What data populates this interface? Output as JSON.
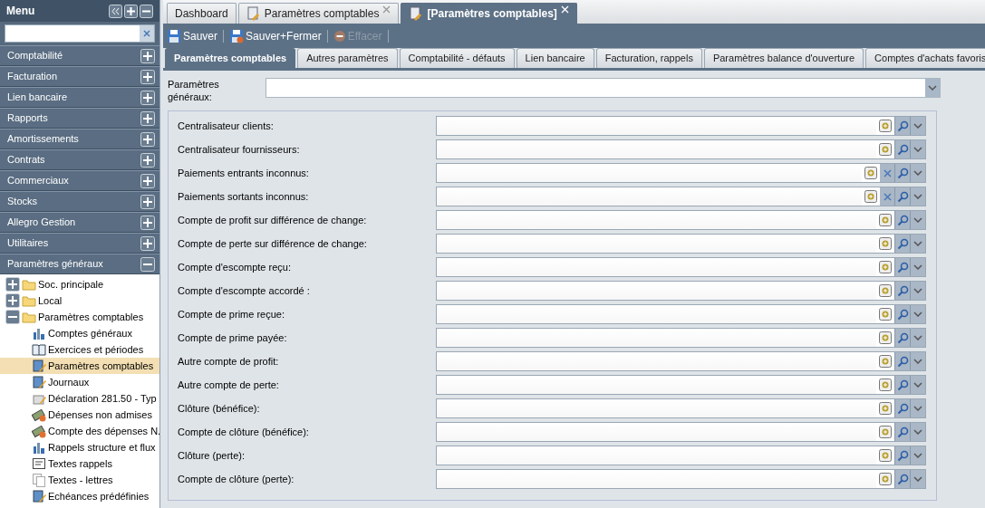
{
  "sidebar": {
    "title": "Menu",
    "search": {
      "clear_button": true
    },
    "sections": [
      {
        "label": "Comptabilité",
        "expanded": false
      },
      {
        "label": "Facturation",
        "expanded": false
      },
      {
        "label": "Lien bancaire",
        "expanded": false
      },
      {
        "label": "Rapports",
        "expanded": false
      },
      {
        "label": "Amortissements",
        "expanded": false
      },
      {
        "label": "Contrats",
        "expanded": false
      },
      {
        "label": "Commerciaux",
        "expanded": false
      },
      {
        "label": "Stocks",
        "expanded": false
      },
      {
        "label": "Allegro Gestion",
        "expanded": false
      },
      {
        "label": "Utilitaires",
        "expanded": false
      },
      {
        "label": "Paramètres généraux",
        "expanded": true
      }
    ],
    "tree": [
      {
        "label": "Soc. principale",
        "kind": "folder",
        "expanded": false,
        "selected": false
      },
      {
        "label": "Local",
        "kind": "folder",
        "expanded": false,
        "selected": false
      },
      {
        "label": "Paramètres comptables",
        "kind": "folder",
        "expanded": true,
        "selected": false,
        "children": [
          {
            "label": "Comptes généraux",
            "kind": "chart",
            "selected": false
          },
          {
            "label": "Exercices et périodes",
            "kind": "book",
            "selected": false
          },
          {
            "label": "Paramètres comptables",
            "kind": "edit",
            "selected": true
          },
          {
            "label": "Journaux",
            "kind": "edit",
            "selected": false
          },
          {
            "label": "Déclaration 281.50 - Typ",
            "kind": "box",
            "selected": false
          },
          {
            "label": "Dépenses non admises",
            "kind": "money",
            "selected": false
          },
          {
            "label": "Compte des dépenses N.",
            "kind": "money",
            "selected": false
          },
          {
            "label": "Rappels structure et flux",
            "kind": "chart",
            "selected": false
          },
          {
            "label": "Textes rappels",
            "kind": "text",
            "selected": false
          },
          {
            "label": "Textes - lettres",
            "kind": "pages",
            "selected": false
          },
          {
            "label": "Echéances prédéfinies",
            "kind": "edit",
            "selected": false
          }
        ]
      }
    ]
  },
  "tabs": [
    {
      "label": "Dashboard",
      "icon": false,
      "closable": false,
      "selected": false
    },
    {
      "label": "Paramètres comptables",
      "icon": true,
      "closable": true,
      "selected": false
    },
    {
      "label": "[Paramètres comptables]",
      "icon": true,
      "closable": true,
      "selected": true
    }
  ],
  "toolbar": [
    {
      "label": "Sauver",
      "kind": "save",
      "disabled": false
    },
    {
      "label": "Sauver+Fermer",
      "kind": "saveclose",
      "disabled": false
    },
    {
      "label": "Effacer",
      "kind": "delete",
      "disabled": true
    }
  ],
  "subtabs": [
    {
      "label": "Paramètres comptables",
      "selected": true
    },
    {
      "label": "Autres paramètres",
      "selected": false
    },
    {
      "label": "Comptabilité - défauts",
      "selected": false
    },
    {
      "label": "Lien bancaire",
      "selected": false
    },
    {
      "label": "Facturation, rappels",
      "selected": false
    },
    {
      "label": "Paramètres balance d'ouverture",
      "selected": false
    },
    {
      "label": "Comptes d'achats favoris",
      "selected": false
    }
  ],
  "general": {
    "label": "Paramètres généraux:"
  },
  "fields": [
    {
      "label": "Centralisateur clients:",
      "clearable": false
    },
    {
      "label": "Centralisateur fournisseurs:",
      "clearable": false
    },
    {
      "label": "Paiements entrants inconnus:",
      "clearable": true
    },
    {
      "label": "Paiements sortants inconnus:",
      "clearable": true
    },
    {
      "label": "Compte de profit sur différence de change:",
      "clearable": false
    },
    {
      "label": "Compte de perte sur différence de change:",
      "clearable": false
    },
    {
      "label": "Compte d'escompte reçu:",
      "clearable": false
    },
    {
      "label": "Compte d'escompte accordé :",
      "clearable": false
    },
    {
      "label": "Compte de prime reçue:",
      "clearable": false
    },
    {
      "label": "Compte de prime payée:",
      "clearable": false
    },
    {
      "label": "Autre compte de profit:",
      "clearable": false
    },
    {
      "label": "Autre compte de perte:",
      "clearable": false
    },
    {
      "label": "Clôture (bénéfice):",
      "clearable": false
    },
    {
      "label": "Compte de clôture (bénéfice):",
      "clearable": false
    },
    {
      "label": "Clôture (perte):",
      "clearable": false
    },
    {
      "label": "Compte de clôture (perte):",
      "clearable": false
    }
  ]
}
